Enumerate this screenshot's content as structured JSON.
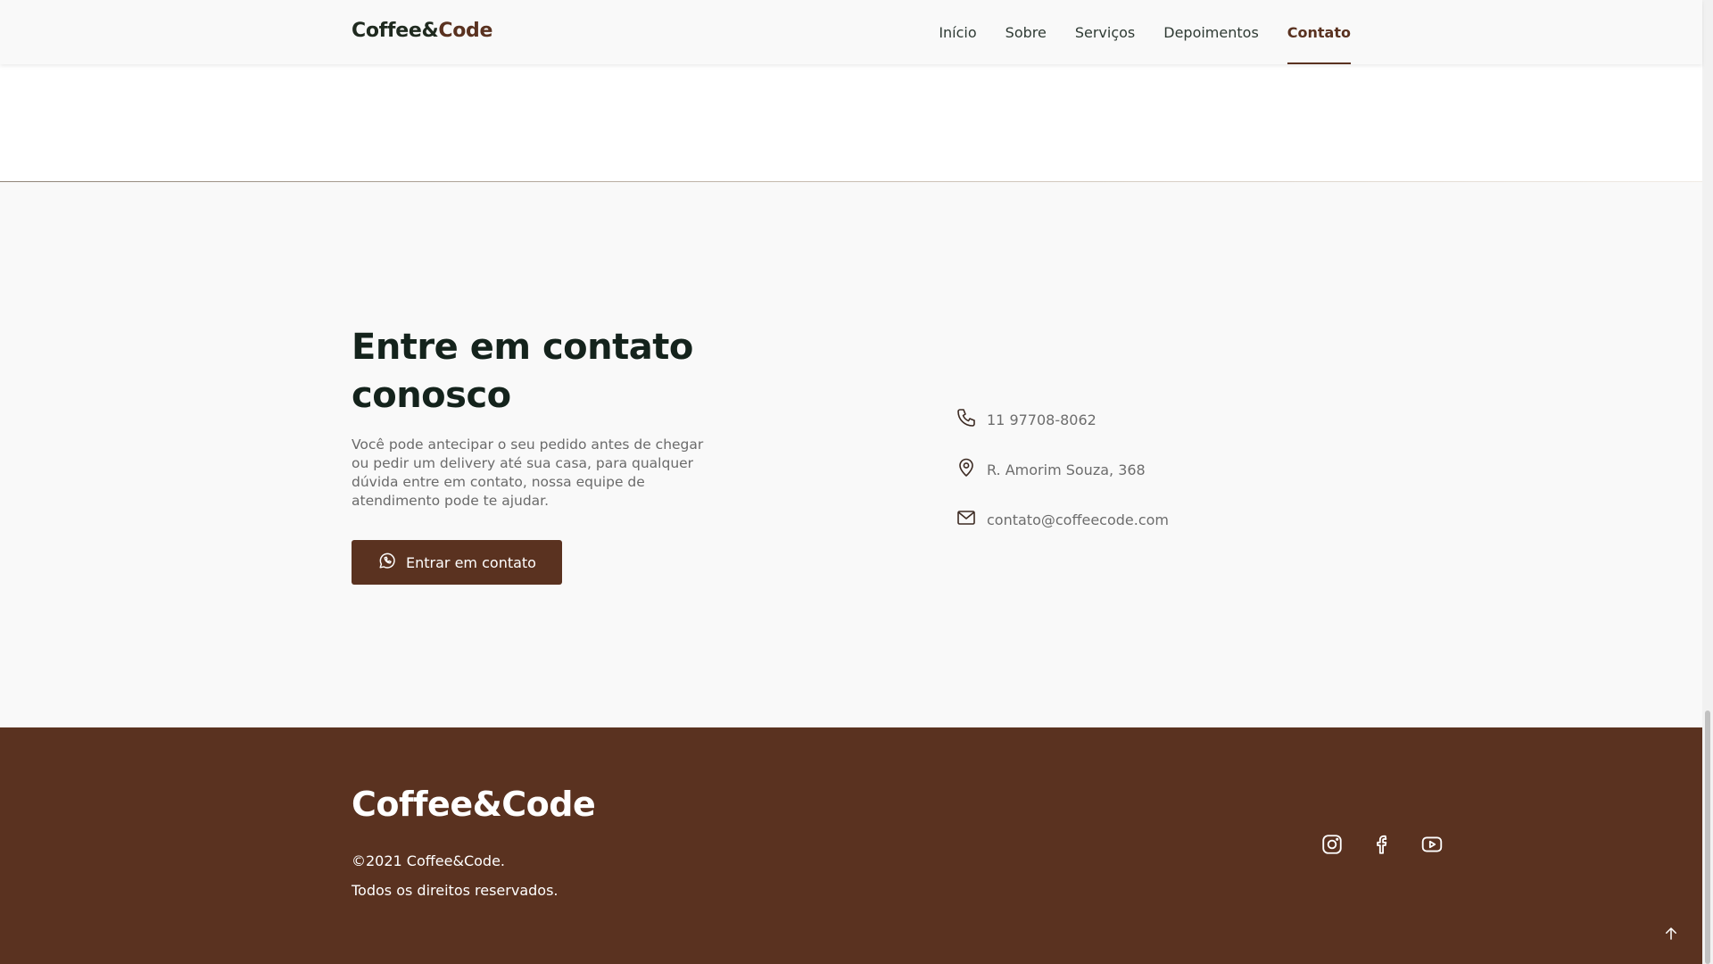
{
  "header": {
    "brand_main": "Coffee&",
    "brand_accent": "Code",
    "nav": [
      {
        "label": "Início"
      },
      {
        "label": "Sobre"
      },
      {
        "label": "Serviços"
      },
      {
        "label": "Depoimentos"
      },
      {
        "label": "Contato",
        "active": true
      }
    ]
  },
  "contact": {
    "title": "Entre em contato conosco",
    "description": "Você pode antecipar o seu pedido antes de chegar ou pedir um delivery até sua casa, para qualquer dúvida entre em contato, nossa equipe de atendimento pode te ajudar.",
    "button_label": "Entrar em contato",
    "button_icon": "whatsapp-icon",
    "info": [
      {
        "icon": "phone-icon",
        "text": "11 97708-8062"
      },
      {
        "icon": "location-pin-icon",
        "text": "R. Amorim Souza, 368"
      },
      {
        "icon": "mail-icon",
        "text": "contato@coffeecode.com"
      }
    ]
  },
  "footer": {
    "brand": "Coffee&Code",
    "copyright": "©2021 Coffee&Code.",
    "rights": "Todos os direitos reservados.",
    "social": [
      "instagram-icon",
      "facebook-icon",
      "youtube-icon"
    ],
    "back_to_top_icon": "arrow-up-icon"
  },
  "colors": {
    "brand_brown": "#5a3220",
    "dark_text": "#14231c",
    "section_bg": "#f9f9f9",
    "muted_text": "#6a6a6a"
  }
}
